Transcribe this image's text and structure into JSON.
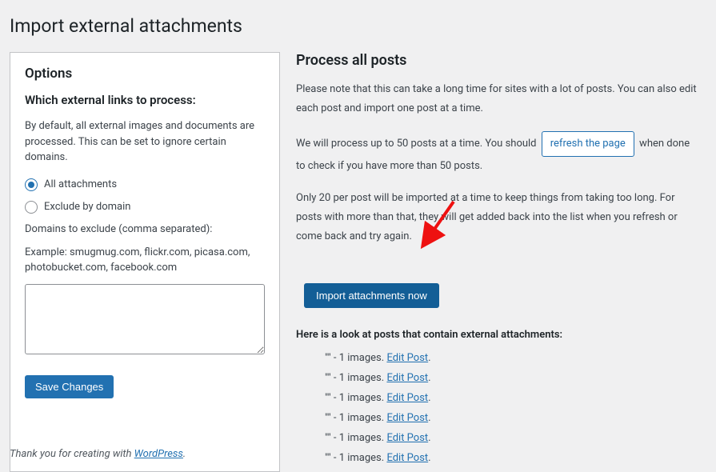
{
  "page_title": "Import external attachments",
  "left": {
    "options_heading": "Options",
    "sub_heading": "Which external links to process:",
    "description": "By default, all external images and documents are processed. This can be set to ignore certain domains.",
    "radio_all": "All attachments",
    "radio_exclude": "Exclude by domain",
    "radio_selected": "all",
    "domains_label": "Domains to exclude (comma separated):",
    "example": "Example: smugmug.com, flickr.com, picasa.com, photobucket.com, facebook.com",
    "textarea_value": "",
    "save_label": "Save Changes"
  },
  "right": {
    "heading": "Process all posts",
    "note1": "Please note that this can take a long time for sites with a lot of posts. You can also edit each post and import one post at a time.",
    "note2_a": "We will process up to 50 posts at a time. You should ",
    "refresh_label": "refresh the page",
    "note2_b": " when done to check if you have more than 50 posts.",
    "note3": "Only 20 per post will be imported at a time to keep things from taking too long. For posts with more than that, they will get added back into the list when you refresh or come back and try again.",
    "action_label": "Import attachments now",
    "posts_look_label": "Here is a look at posts that contain external attachments:",
    "posts": [
      {
        "title": "\"\"",
        "count_text": "1 images.",
        "edit_label": "Edit Post"
      },
      {
        "title": "\"\"",
        "count_text": "1 images.",
        "edit_label": "Edit Post"
      },
      {
        "title": "\"\"",
        "count_text": "1 images.",
        "edit_label": "Edit Post"
      },
      {
        "title": "\"\"",
        "count_text": "1 images.",
        "edit_label": "Edit Post"
      },
      {
        "title": "\"\"",
        "count_text": "1 images.",
        "edit_label": "Edit Post"
      },
      {
        "title": "\"\"",
        "count_text": "1 images.",
        "edit_label": "Edit Post"
      }
    ]
  },
  "footer": {
    "text_a": "Thank you for creating with ",
    "link_label": "WordPress",
    "text_b": "."
  }
}
